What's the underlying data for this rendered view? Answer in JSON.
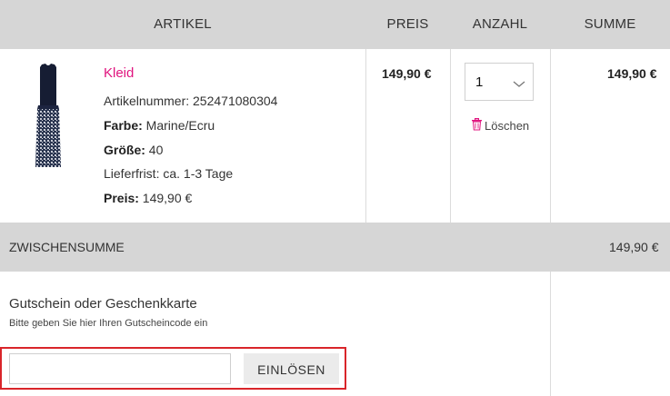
{
  "table": {
    "headers": {
      "artikel": "ARTIKEL",
      "preis": "PREIS",
      "anzahl": "ANZAHL",
      "summe": "SUMME"
    }
  },
  "item": {
    "name": "Kleid",
    "article_number": "Artikelnummer: 252471080304",
    "color_label": "Farbe:",
    "color_value": " Marine/Ecru",
    "size_label": "Größe:",
    "size_value": " 40",
    "delivery": "Lieferfrist: ca. 1-3 Tage",
    "price_label": "Preis:",
    "price_value": " 149,90 €",
    "unit_price": "149,90 €",
    "quantity": "1",
    "delete_label": "Löschen",
    "row_total": "149,90 €",
    "image_icon": "dress-image"
  },
  "subtotal": {
    "label": "ZWISCHENSUMME",
    "value": "149,90 €"
  },
  "coupon": {
    "title": "Gutschein oder Geschenkkarte",
    "help": "Bitte geben Sie hier Ihren Gutscheincode ein",
    "input_value": "",
    "input_placeholder": "",
    "button_label": "EINLÖSEN"
  },
  "colors": {
    "accent": "#e0137e",
    "header_bg": "#d6d6d6",
    "highlight_border": "#d9252a",
    "button_bg": "#ebebeb"
  }
}
